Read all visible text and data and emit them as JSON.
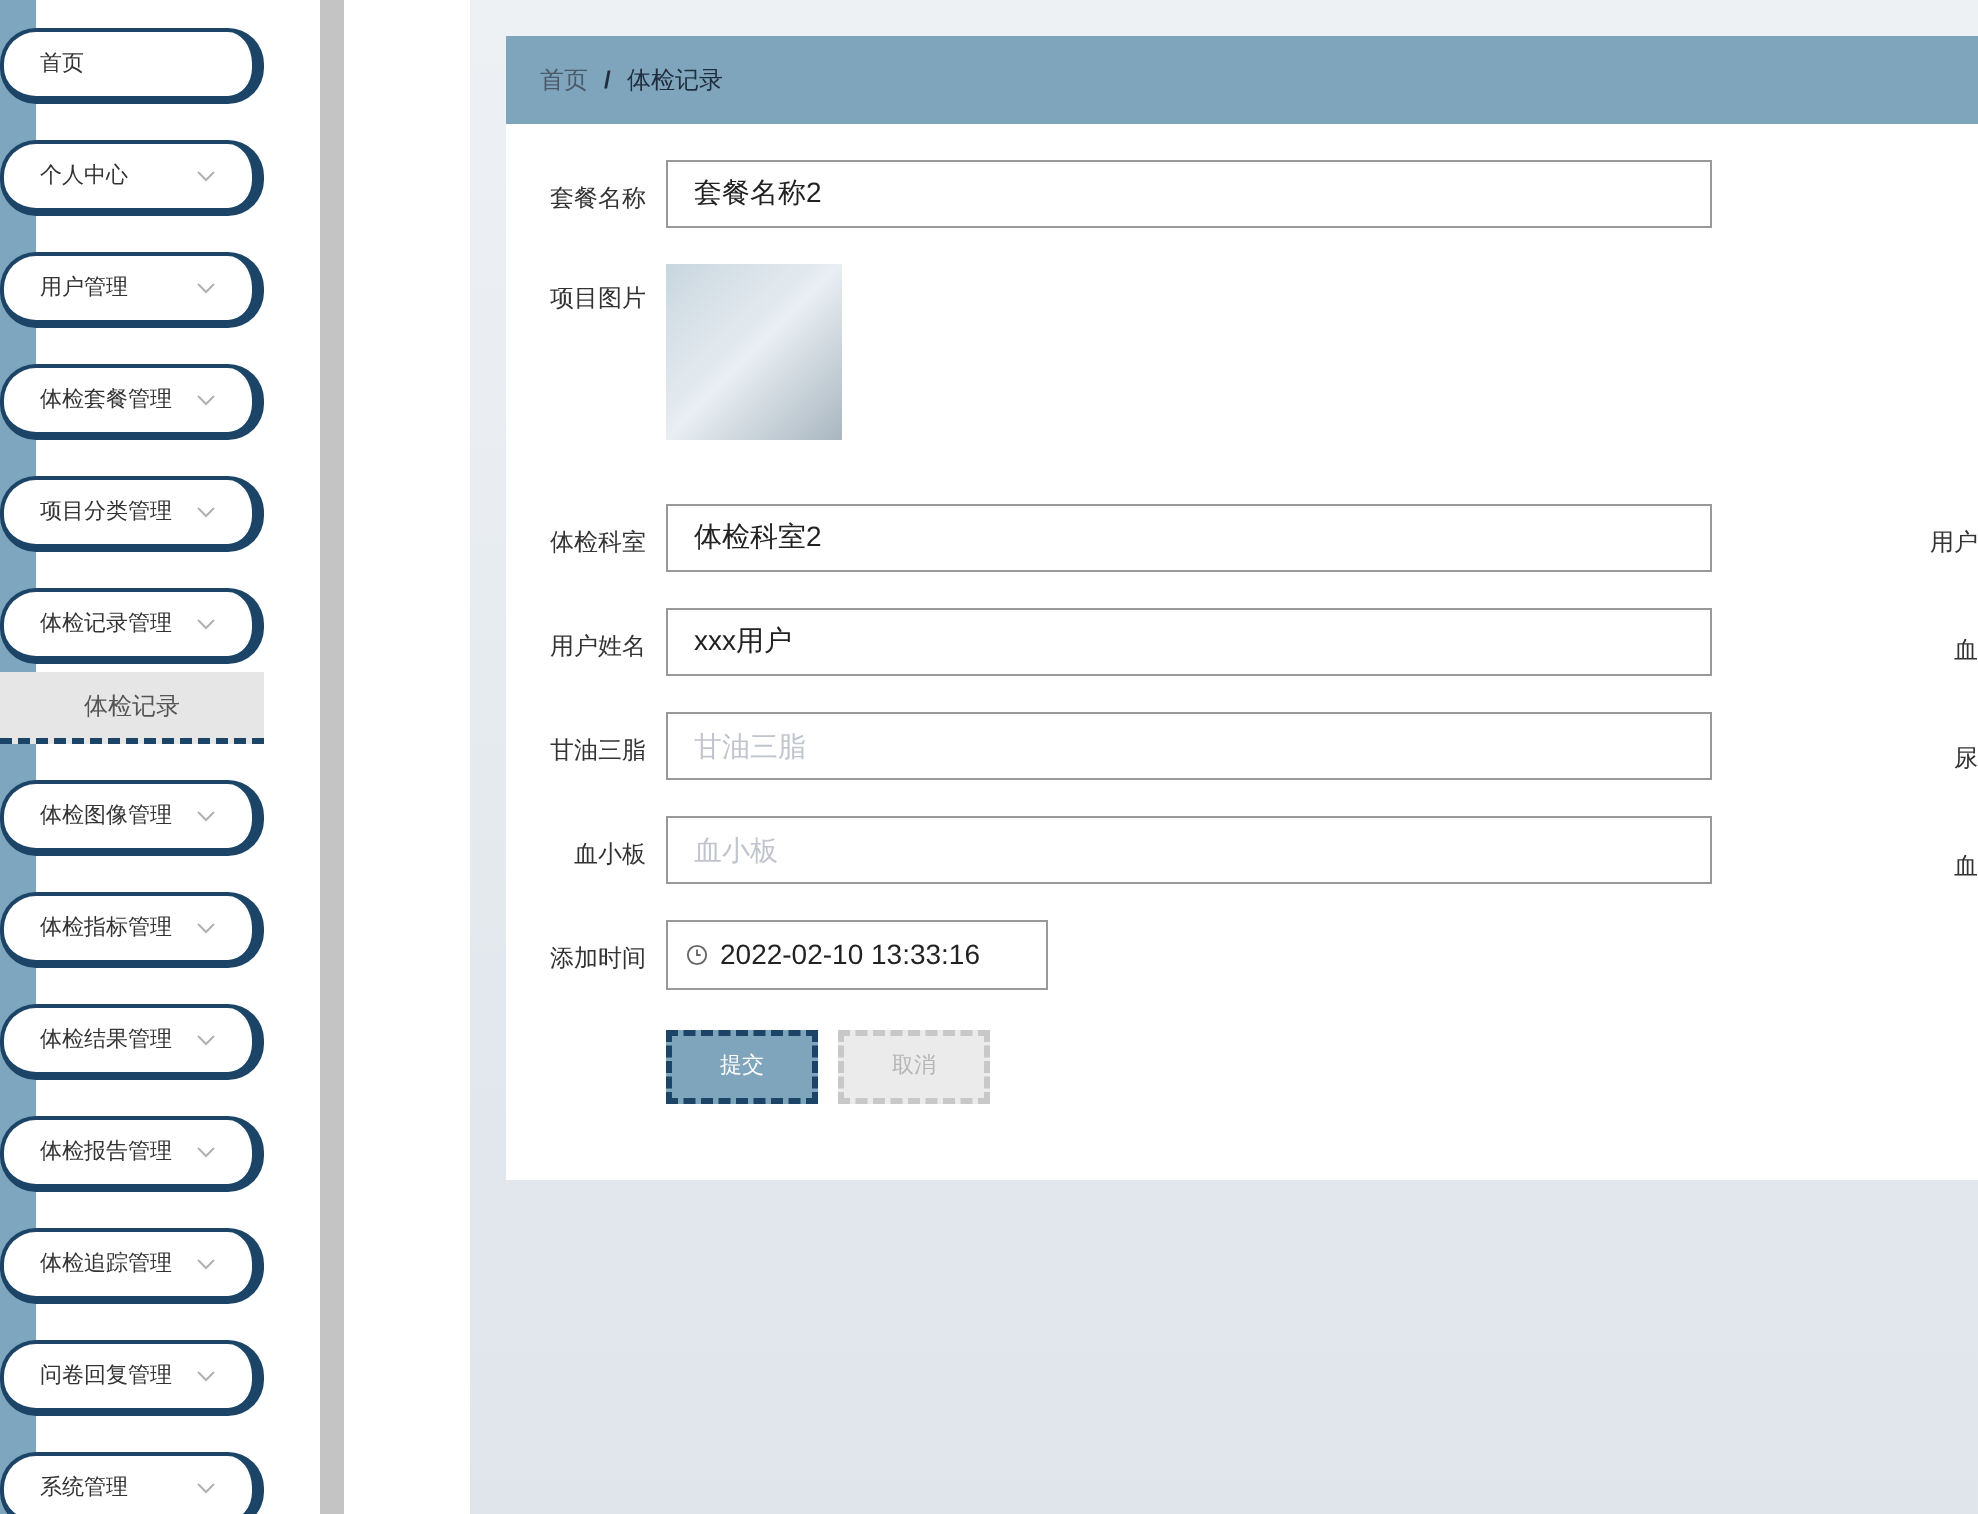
{
  "sidebar": {
    "items": [
      {
        "kind": "link",
        "label": "首页"
      },
      {
        "kind": "menu",
        "label": "个人中心"
      },
      {
        "kind": "menu",
        "label": "用户管理"
      },
      {
        "kind": "menu",
        "label": "体检套餐管理"
      },
      {
        "kind": "menu",
        "label": "项目分类管理"
      },
      {
        "kind": "menu",
        "label": "体检记录管理",
        "children": [
          {
            "label": "体检记录",
            "selected": true
          }
        ]
      },
      {
        "kind": "menu",
        "label": "体检图像管理"
      },
      {
        "kind": "menu",
        "label": "体检指标管理"
      },
      {
        "kind": "menu",
        "label": "体检结果管理"
      },
      {
        "kind": "menu",
        "label": "体检报告管理"
      },
      {
        "kind": "menu",
        "label": "体检追踪管理"
      },
      {
        "kind": "menu",
        "label": "问卷回复管理"
      },
      {
        "kind": "menu",
        "label": "系统管理"
      }
    ]
  },
  "breadcrumb": {
    "items": [
      "首页",
      "体检记录"
    ],
    "separator": "/"
  },
  "form": {
    "fields": [
      {
        "kind": "text",
        "label": "套餐名称",
        "value": "套餐名称2"
      },
      {
        "kind": "image",
        "label": "项目图片"
      },
      {
        "kind": "text",
        "label": "体检科室",
        "value": "体检科室2"
      },
      {
        "kind": "text",
        "label": "用户姓名",
        "value": "xxx用户"
      },
      {
        "kind": "text",
        "label": "甘油三脂",
        "placeholder": "甘油三脂"
      },
      {
        "kind": "text",
        "label": "血小板",
        "placeholder": "血小板"
      },
      {
        "kind": "datetime",
        "label": "添加时间",
        "value": "2022-02-10 13:33:16"
      }
    ],
    "right_labels": [
      "用户",
      "血",
      "尿",
      "血"
    ],
    "buttons": [
      {
        "kind": "primary",
        "label": "提交"
      },
      {
        "kind": "secondary",
        "label": "取消"
      }
    ]
  }
}
